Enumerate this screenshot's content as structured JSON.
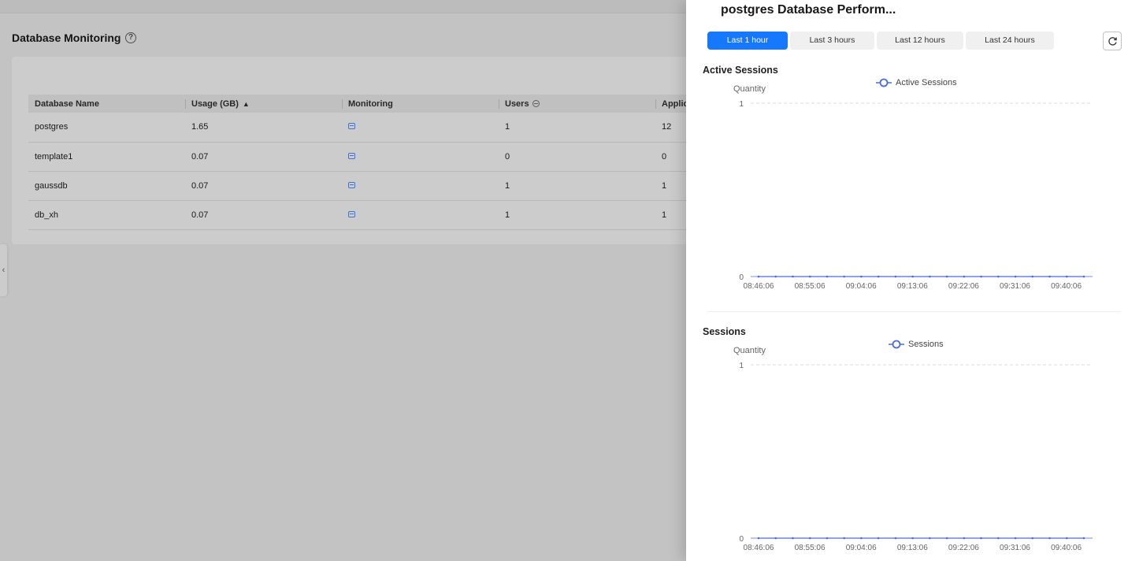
{
  "page": {
    "title": "Database Monitoring",
    "help_icon": "question-circle-icon",
    "collapse_icon": "chevron-left-icon"
  },
  "table": {
    "columns": [
      {
        "label": "Database Name",
        "icon": ""
      },
      {
        "label": "Usage (GB)",
        "icon": "sort-icon"
      },
      {
        "label": "Monitoring",
        "icon": ""
      },
      {
        "label": "Users",
        "icon": "filter-icon"
      },
      {
        "label": "Applic",
        "icon": ""
      }
    ],
    "rows": [
      {
        "name": "postgres",
        "usage": "1.65",
        "monitoring_icon": "monitor-icon",
        "users": "1",
        "applic": "12"
      },
      {
        "name": "template1",
        "usage": "0.07",
        "monitoring_icon": "monitor-icon",
        "users": "0",
        "applic": "0"
      },
      {
        "name": "gaussdb",
        "usage": "0.07",
        "monitoring_icon": "monitor-icon",
        "users": "1",
        "applic": "1"
      },
      {
        "name": "db_xh",
        "usage": "0.07",
        "monitoring_icon": "monitor-icon",
        "users": "1",
        "applic": "1"
      }
    ]
  },
  "drawer": {
    "title": "postgres Database Perform...",
    "tabs": [
      {
        "label": "Last 1 hour",
        "active": true
      },
      {
        "label": "Last 3 hours",
        "active": false
      },
      {
        "label": "Last 12 hours",
        "active": false
      },
      {
        "label": "Last 24 hours",
        "active": false
      }
    ],
    "refresh_icon": "refresh-icon",
    "accent_color": "#1677ff",
    "series_color": "#4e6bd9"
  },
  "chart_data": [
    {
      "type": "line",
      "title": "Active Sessions",
      "ylabel": "Quantity",
      "xlabel": "",
      "ylim": [
        0,
        1
      ],
      "y_ticks": [
        "1",
        "0"
      ],
      "x_tick_labels": [
        "08:46:06",
        "08:55:06",
        "09:04:06",
        "09:13:06",
        "09:22:06",
        "09:31:06",
        "09:40:06"
      ],
      "legend": "top-center",
      "grid": true,
      "series": [
        {
          "name": "Active Sessions",
          "values": [
            0,
            0,
            0,
            0,
            0,
            0,
            0,
            0,
            0,
            0,
            0,
            0,
            0,
            0,
            0,
            0,
            0,
            0,
            0,
            0
          ]
        }
      ]
    },
    {
      "type": "line",
      "title": "Sessions",
      "ylabel": "Quantity",
      "xlabel": "",
      "ylim": [
        0,
        1
      ],
      "y_ticks": [
        "1",
        "0"
      ],
      "x_tick_labels": [
        "08:46:06",
        "08:55:06",
        "09:04:06",
        "09:13:06",
        "09:22:06",
        "09:31:06",
        "09:40:06"
      ],
      "legend": "top-center",
      "grid": true,
      "series": [
        {
          "name": "Sessions",
          "values": [
            0,
            0,
            0,
            0,
            0,
            0,
            0,
            0,
            0,
            0,
            0,
            0,
            0,
            0,
            0,
            0,
            0,
            0,
            0,
            0
          ]
        }
      ]
    }
  ]
}
